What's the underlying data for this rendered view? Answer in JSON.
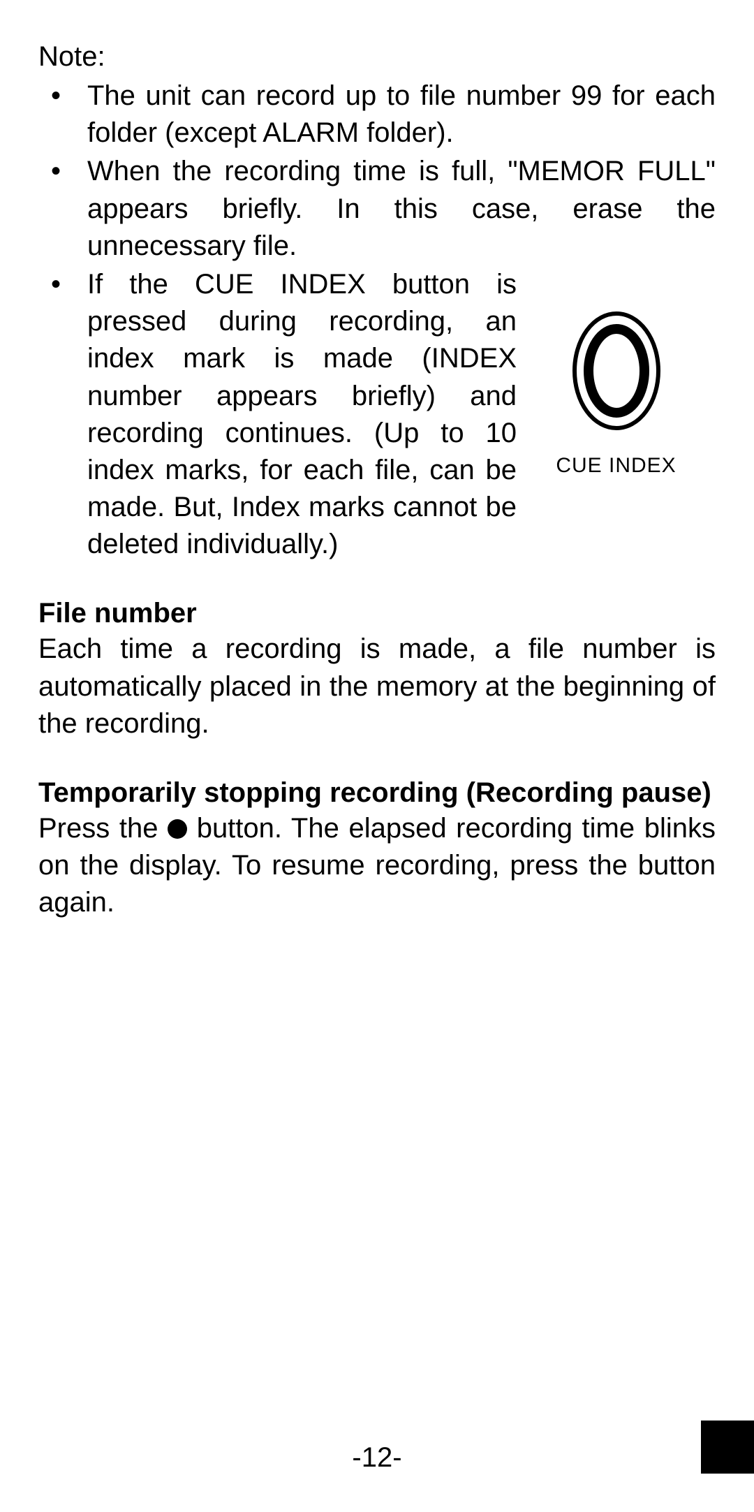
{
  "note_label": "Note:",
  "bullets": {
    "b1": "The unit can record up to file number 99 for each folder (except ALARM folder).",
    "b2": "When the recording time is full, \"MEMOR FULL\" appears briefly. In this case, erase the unnecessary file.",
    "b3": "If the CUE INDEX button is pressed during recording, an index mark is made (INDEX number appears briefly) and recording continues. (Up to 10 index marks, for each file, can be made. But, Index marks cannot be deleted individually.)"
  },
  "figure": {
    "caption": "CUE INDEX"
  },
  "section1": {
    "heading": "File number",
    "body": "Each time a recording is made, a file number is automatically placed in the memory at the beginning of the recording."
  },
  "section2": {
    "heading": "Temporarily stopping recording (Recording pause)",
    "body_a": "Press the ",
    "body_b": " button. The elapsed recording time blinks on the display. To resume recording, press the button again."
  },
  "page_number": "-12-"
}
